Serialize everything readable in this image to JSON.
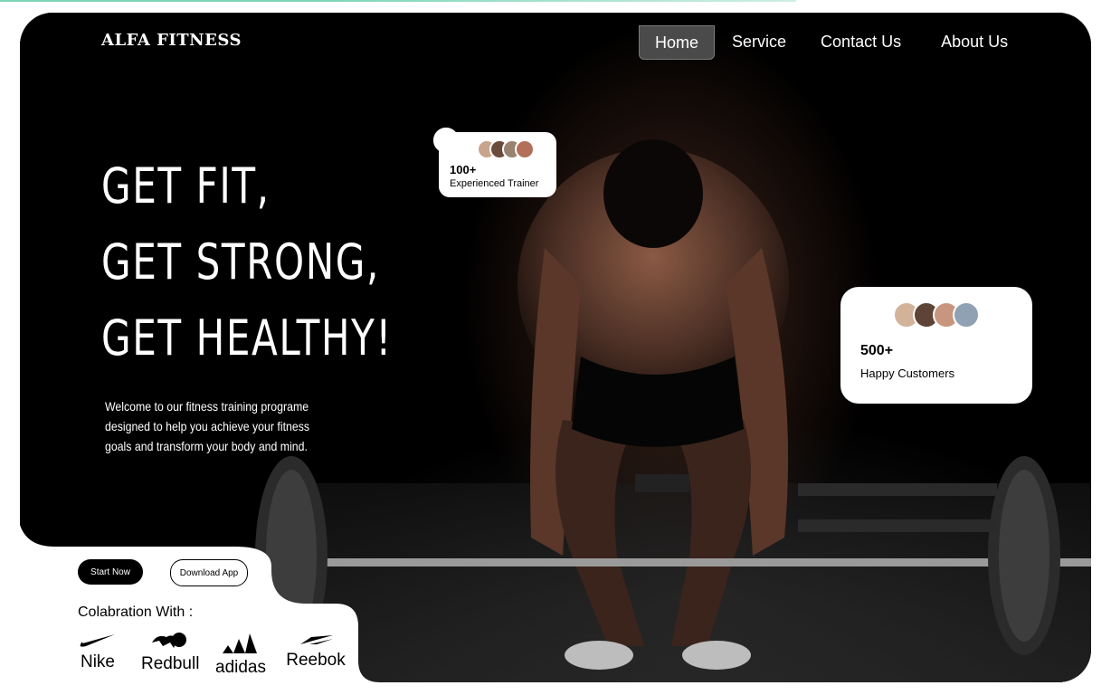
{
  "brand": "ALFA FITNESS",
  "nav": {
    "items": [
      "Home",
      "Service",
      "Contact Us",
      "About Us"
    ],
    "active": "Home"
  },
  "hero": {
    "headline": [
      "GET FIT,",
      "GET STRONG,",
      "GET HEALTHY!"
    ],
    "welcome": "Welcome to our fitness training programe designed to help you achieve your fitness goals and transform your body and mind."
  },
  "stats": [
    {
      "number": "100+",
      "label": "Experienced Trainer"
    },
    {
      "number": "500+",
      "label": "Happy Customers"
    }
  ],
  "buttons": {
    "start": "Start Now",
    "download": "Download App"
  },
  "collaboration": {
    "title": "Colabration With :",
    "partners": [
      "Nike",
      "Redbull",
      "adidas",
      "Reebok"
    ]
  },
  "icons": {
    "star": "star-icon",
    "avatar": "avatar"
  },
  "colors": {
    "background": "#000000",
    "card": "#ffffff",
    "accent_line": "#7ed6b9",
    "nav_active": "#4a4a4a"
  }
}
